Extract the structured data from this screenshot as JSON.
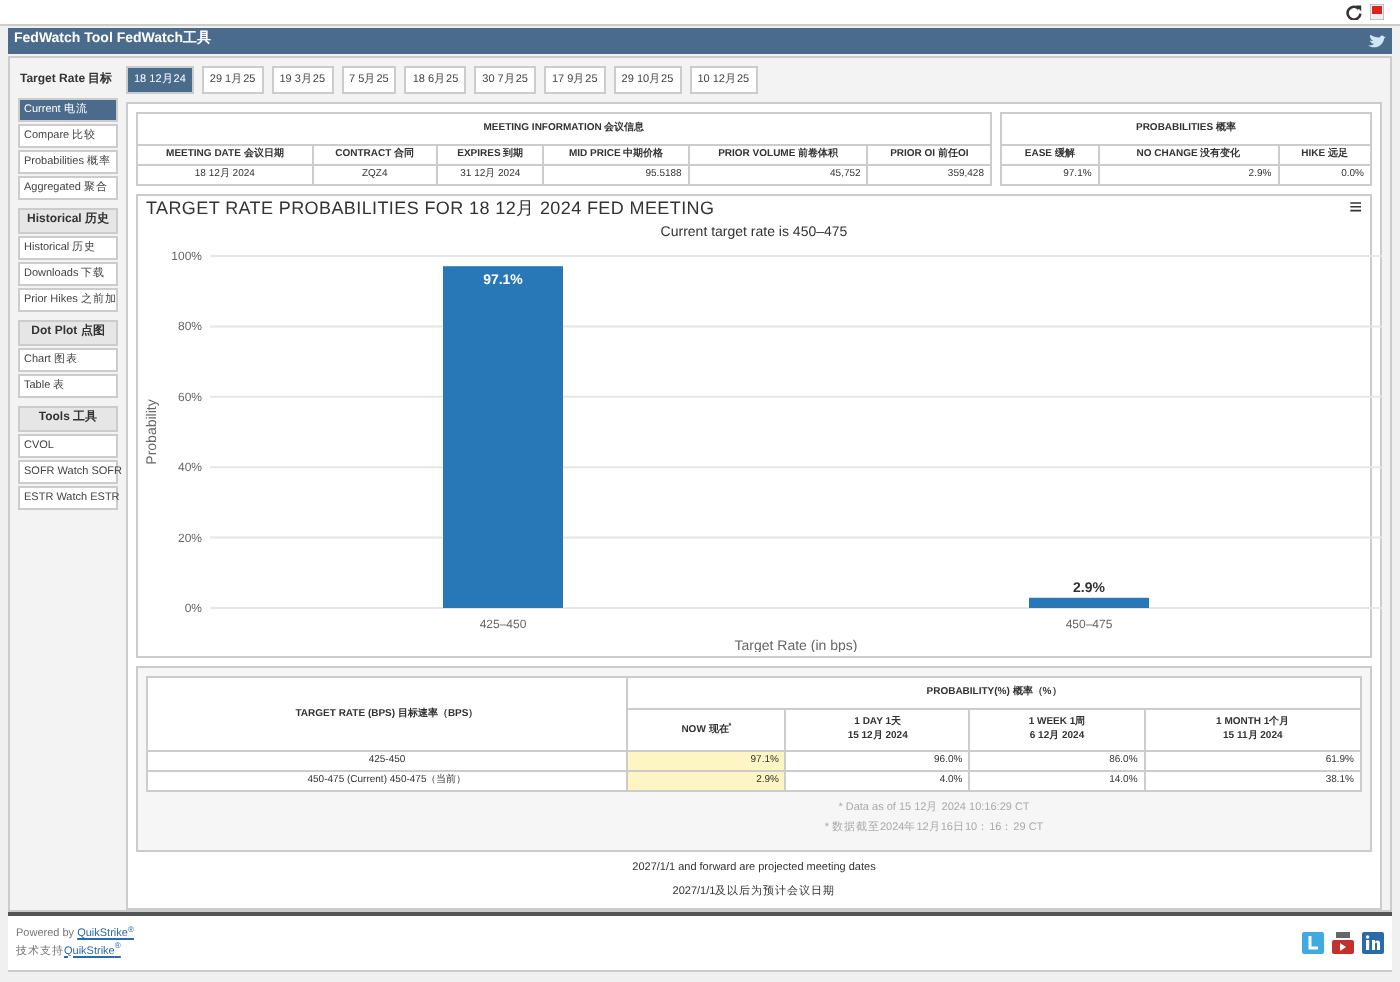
{
  "window": {
    "title": "FedWatch Tool FedWatch工具"
  },
  "sidebar": {
    "groups": [
      {
        "heading": "Target Rate 目标",
        "items": [
          {
            "label": "Current 电流",
            "selected": true
          },
          {
            "label": "Compare 比较",
            "selected": false
          },
          {
            "label": "Probabilities 概率",
            "selected": false
          },
          {
            "label": "Aggregated 聚合",
            "selected": false
          }
        ]
      },
      {
        "heading": "Historical 历史",
        "items": [
          {
            "label": "Historical 历史",
            "selected": false
          },
          {
            "label": "Downloads 下载",
            "selected": false
          },
          {
            "label": "Prior Hikes 之前加",
            "selected": false
          }
        ]
      },
      {
        "heading": "Dot Plot 点图",
        "items": [
          {
            "label": "Chart 图表",
            "selected": false
          },
          {
            "label": "Table 表",
            "selected": false
          }
        ]
      },
      {
        "heading": "Tools 工具",
        "items": [
          {
            "label": "CVOL",
            "selected": false
          },
          {
            "label": "SOFR Watch SOFR",
            "selected": false
          },
          {
            "label": "ESTR Watch ESTR",
            "selected": false
          }
        ]
      }
    ]
  },
  "tabs": [
    {
      "label": "18 12月24",
      "selected": true
    },
    {
      "label": "29 1月25",
      "selected": false
    },
    {
      "label": "19 3月25",
      "selected": false
    },
    {
      "label": "7 5月25",
      "selected": false
    },
    {
      "label": "18 6月25",
      "selected": false
    },
    {
      "label": "30 7月25",
      "selected": false
    },
    {
      "label": "17 9月25",
      "selected": false
    },
    {
      "label": "29 10月25",
      "selected": false
    },
    {
      "label": "10 12月25",
      "selected": false
    }
  ],
  "meeting_info": {
    "title": "MEETING INFORMATION 会议信息",
    "columns": [
      "MEETING DATE 会议日期",
      "CONTRACT 合同",
      "EXPIRES 到期",
      "MID PRICE 中期价格",
      "PRIOR VOLUME 前卷体积",
      "PRIOR OI 前任OI"
    ],
    "row": [
      "18 12月 2024",
      "ZQZ4",
      "31 12月 2024",
      "95.5188",
      "45,752",
      "359,428"
    ]
  },
  "probabilities": {
    "title": "PROBABILITIES 概率",
    "columns": [
      "EASE 缓解",
      "NO CHANGE 没有变化",
      "HIKE 远足"
    ],
    "row": [
      "97.1%",
      "2.9%",
      "0.0%"
    ]
  },
  "chart_panel": {
    "title": "TARGET RATE PROBABILITIES FOR 18 12月 2024 FED MEETING",
    "subtitle": "Current target rate is 450–475",
    "menu": "≡",
    "chart_data": {
      "type": "bar",
      "xlabel": "Target Rate (in bps)",
      "ylabel": "Probability",
      "categories": [
        "425–450",
        "450–475"
      ],
      "series": [
        {
          "color": "#2878b8",
          "values": [
            97.1,
            2.9
          ]
        }
      ],
      "grid": true,
      "ylim": [
        0,
        100
      ],
      "yticks": [
        {
          "value": 0,
          "label": "0%"
        },
        {
          "value": 20,
          "label": "20%"
        },
        {
          "value": 40,
          "label": "40%"
        },
        {
          "value": 60,
          "label": "60%"
        },
        {
          "value": 80,
          "label": "80%"
        },
        {
          "value": 100,
          "label": "100%"
        }
      ],
      "value_labels": [
        "97.1%",
        "2.9%"
      ]
    }
  },
  "probability_table": {
    "group_header": "PROBABILITY(%) 概率（%）",
    "columns": [
      {
        "label": "TARGET RATE (BPS) 目标速率（BPS）",
        "highlighted": false
      },
      {
        "label": "NOW 现在$^{*}$",
        "highlighted": true
      },
      {
        "label": "1 DAY 1天",
        "date": "15 12月 2024",
        "highlighted": false
      },
      {
        "label": "1 WEEK 1周",
        "date": "6 12月 2024",
        "highlighted": false
      },
      {
        "label": "1 MONTH 1个月",
        "date": "15 11月 2024",
        "highlighted": false
      }
    ],
    "rows": [
      [
        "425-450",
        "97.1%",
        "96.0%",
        "86.0%",
        "61.9%"
      ],
      [
        "450-475 (Current) 450-475（当前）",
        "2.9%",
        "4.0%",
        "14.0%",
        "38.1%"
      ]
    ],
    "notes": [
      "* Data as of 15 12月 2024 10:16:29 CT",
      "* 数据截至2024年12月16日10：16：29 CT"
    ]
  },
  "footnotes": [
    "2027/1/1 and forward are projected meeting dates",
    "2027/1/1及以后为预计会议日期"
  ],
  "footer": [
    {
      "prefix": "Powered by ",
      "link": "QuikStrike",
      "mark": "®"
    },
    {
      "prefix": "技术支持",
      "link": "QuikStrike",
      "mark": "®"
    }
  ]
}
